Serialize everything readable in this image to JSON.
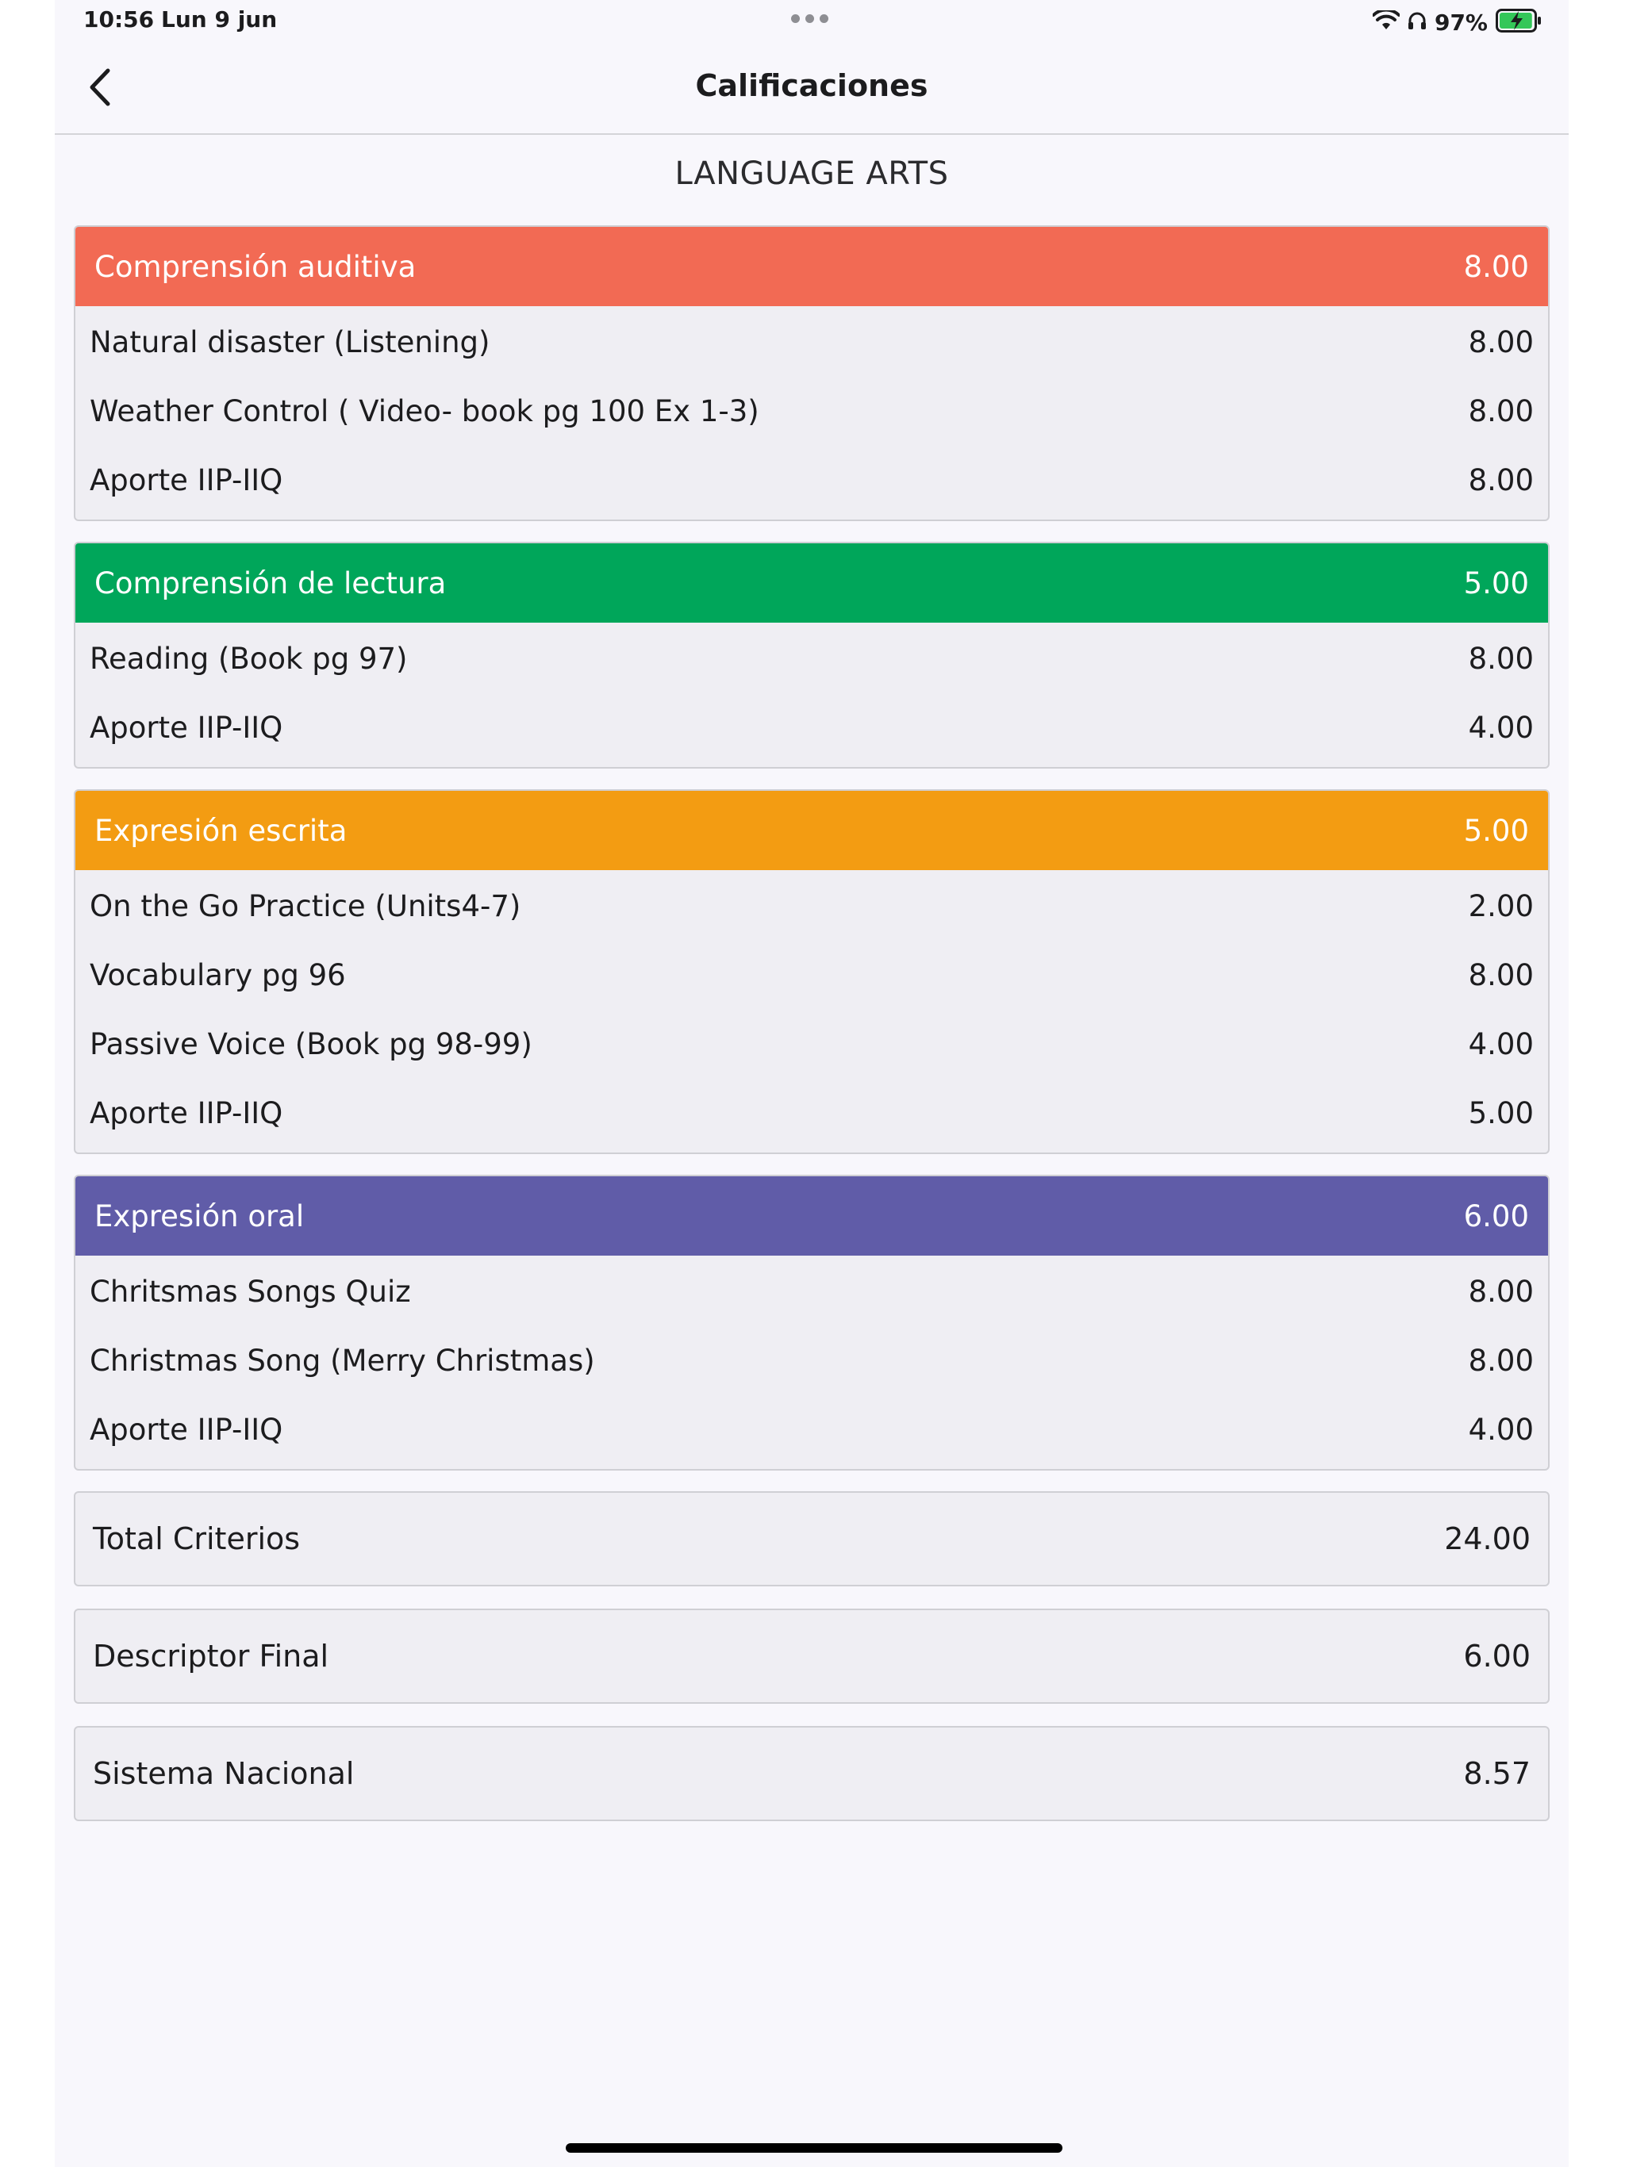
{
  "status": {
    "time": "10:56",
    "date": "Lun 9 jun",
    "battery_pct": "97%",
    "battery_level": 0.97
  },
  "nav": {
    "title": "Calificaciones"
  },
  "subject": "LANGUAGE ARTS",
  "colors": {
    "auditiva": "#f26a54",
    "lectura": "#00a65a",
    "escrita": "#f39c12",
    "oral": "#605ca8"
  },
  "sections": [
    {
      "title": "Comprensión auditiva",
      "score": "8.00",
      "items": [
        {
          "label": "Natural disaster (Listening)",
          "score": "8.00"
        },
        {
          "label": "Weather Control ( Video- book pg 100 Ex 1-3)",
          "score": "8.00"
        },
        {
          "label": "Aporte IIP-IIQ",
          "score": "8.00"
        }
      ]
    },
    {
      "title": "Comprensión de lectura",
      "score": "5.00",
      "items": [
        {
          "label": "Reading (Book pg 97)",
          "score": "8.00"
        },
        {
          "label": "Aporte IIP-IIQ",
          "score": "4.00"
        }
      ]
    },
    {
      "title": "Expresión escrita",
      "score": "5.00",
      "items": [
        {
          "label": "On the Go Practice (Units4-7)",
          "score": "2.00"
        },
        {
          "label": "Vocabulary pg 96",
          "score": "8.00"
        },
        {
          "label": "Passive Voice (Book pg 98-99)",
          "score": "4.00"
        },
        {
          "label": "Aporte IIP-IIQ",
          "score": "5.00"
        }
      ]
    },
    {
      "title": "Expresión oral",
      "score": "6.00",
      "items": [
        {
          "label": "Chritsmas Songs Quiz",
          "score": "8.00"
        },
        {
          "label": "Christmas Song (Merry Christmas)",
          "score": "8.00"
        },
        {
          "label": "Aporte IIP-IIQ",
          "score": "4.00"
        }
      ]
    }
  ],
  "summary": [
    {
      "label": "Total Criterios",
      "value": "24.00"
    },
    {
      "label": "Descriptor Final",
      "value": "6.00"
    },
    {
      "label": "Sistema Nacional",
      "value": "8.57"
    }
  ]
}
